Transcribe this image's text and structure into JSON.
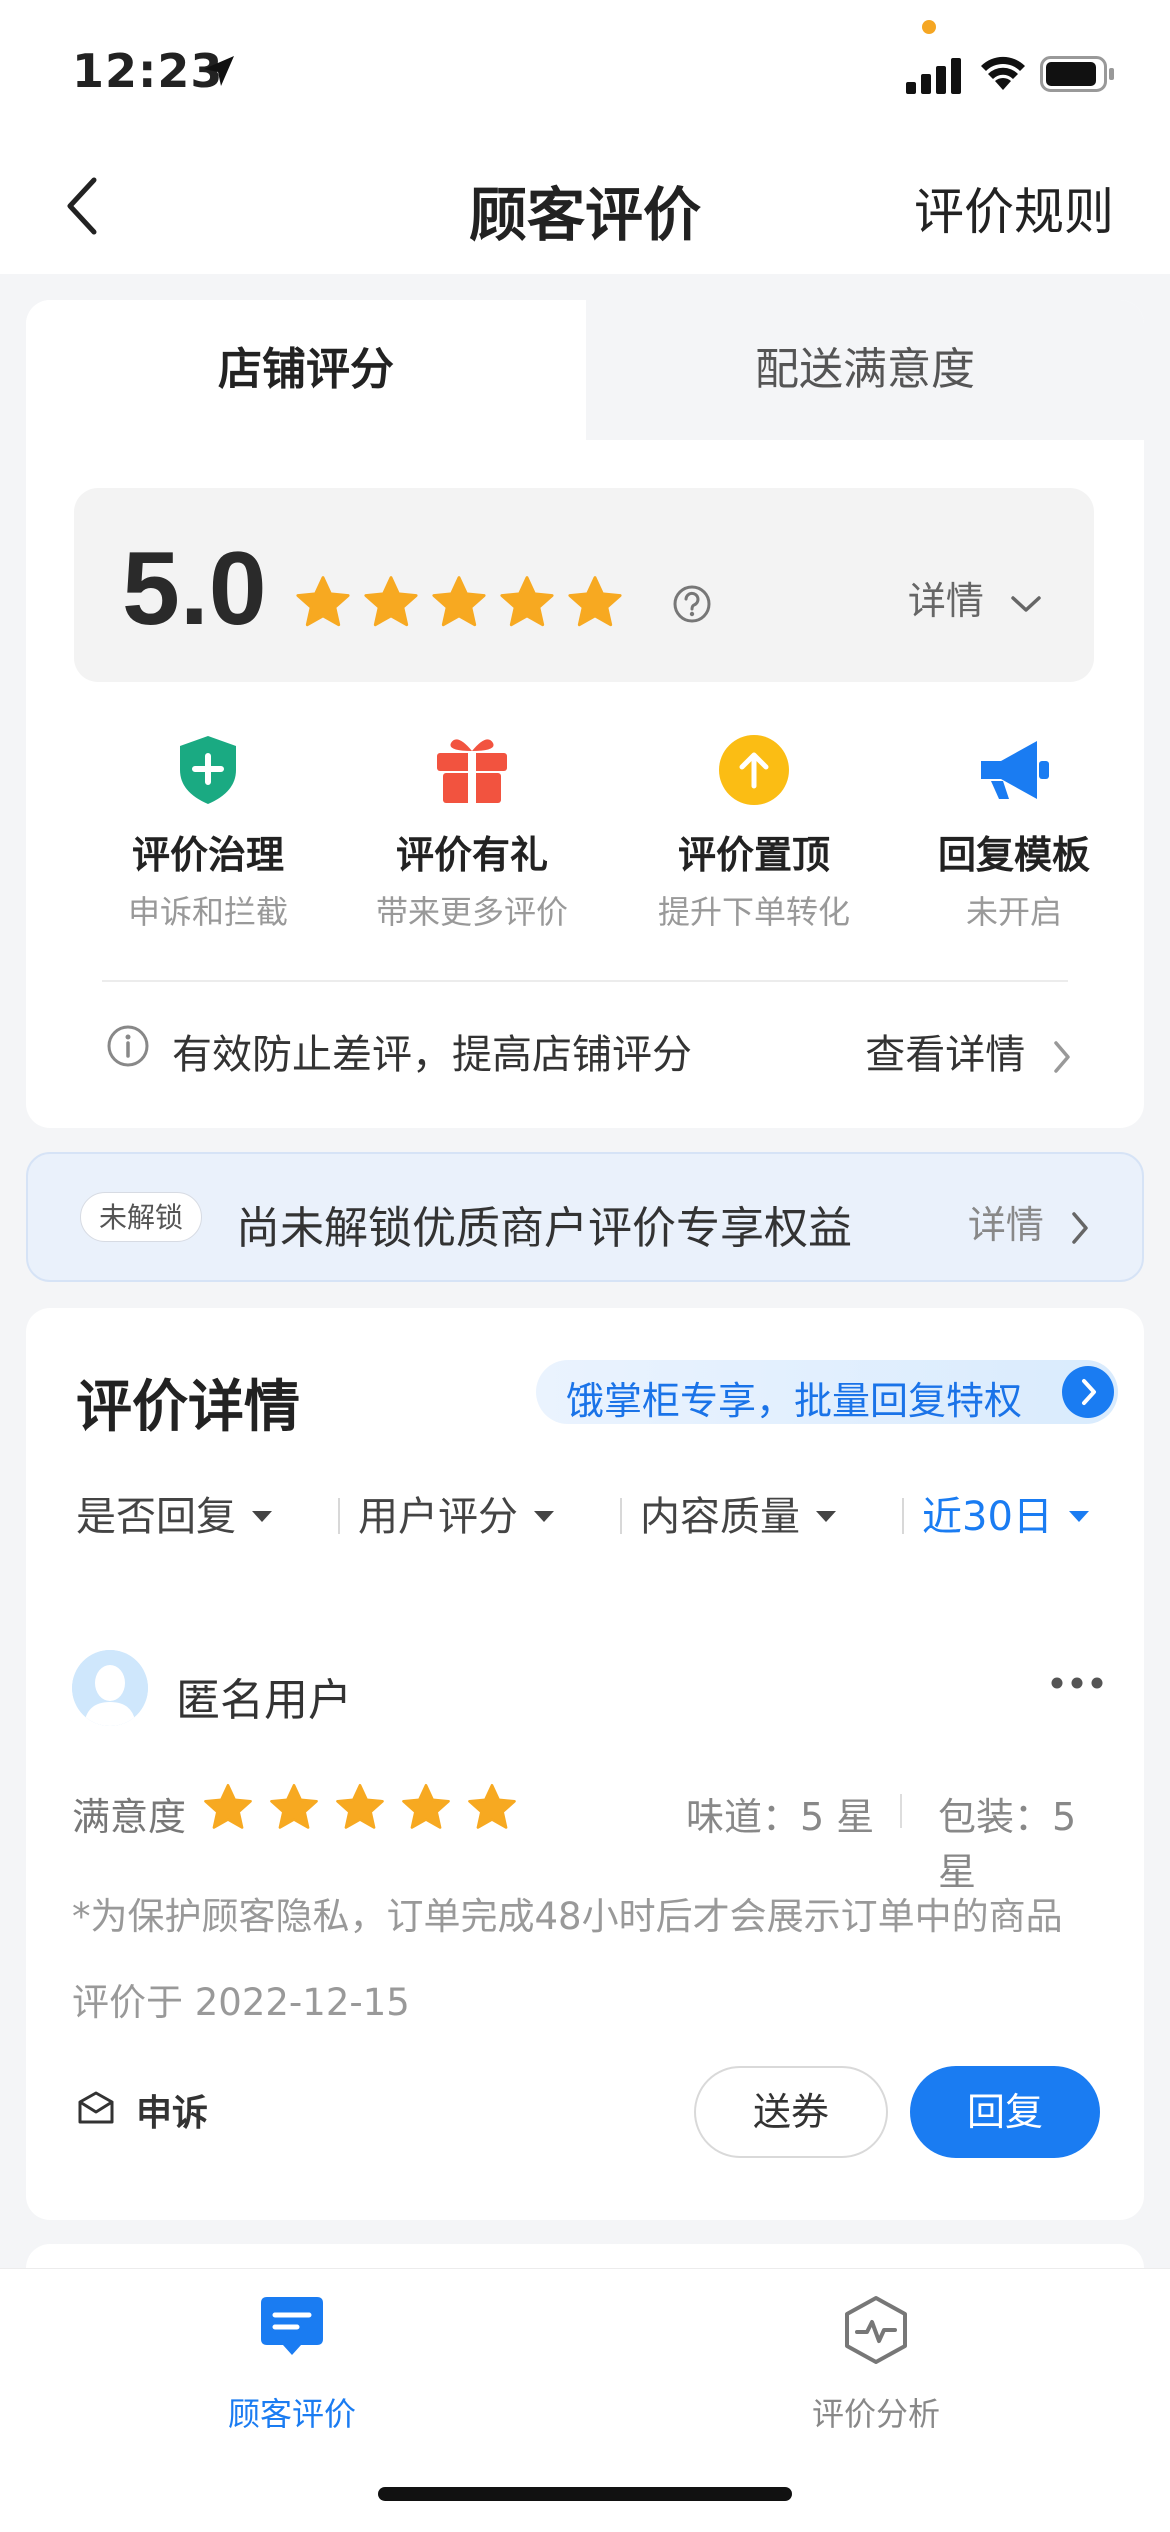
{
  "status_bar": {
    "time": "12:23"
  },
  "nav": {
    "title": "顾客评价",
    "right_action": "评价规则"
  },
  "score_card": {
    "tabs": [
      "店铺评分",
      "配送满意度"
    ],
    "active_tab": "店铺评分",
    "score": "5.0",
    "stars": 5,
    "detail_label": "详情",
    "features": [
      {
        "name": "评价治理",
        "sub": "申诉和拦截",
        "icon": "shield-plus-icon",
        "color": "#1aaa82"
      },
      {
        "name": "评价有礼",
        "sub": "带来更多评价",
        "icon": "gift-icon",
        "color": "#f2533f"
      },
      {
        "name": "评价置顶",
        "sub": "提升下单转化",
        "icon": "arrow-up-circle-icon",
        "color": "#fbbd14"
      },
      {
        "name": "回复模板",
        "sub": "未开启",
        "icon": "megaphone-icon",
        "color": "#1a7cf2"
      }
    ],
    "tip": {
      "text": "有效防止差评，提高店铺评分",
      "action": "查看详情"
    }
  },
  "unlock_banner": {
    "badge": "未解锁",
    "text": "尚未解锁优质商户评价专享权益",
    "action": "详情"
  },
  "review_section": {
    "title": "评价详情",
    "promo": "饿掌柜专享，批量回复特权",
    "filters": [
      {
        "label": "是否回复",
        "active": false
      },
      {
        "label": "用户评分",
        "active": false
      },
      {
        "label": "内容质量",
        "active": false
      },
      {
        "label": "近30日",
        "active": true
      }
    ],
    "review": {
      "user_name": "匿名用户",
      "satisfaction_label": "满意度",
      "stars": 5,
      "taste": "味道：5 星",
      "packaging": "包装：5 星",
      "privacy_note": "*为保护顾客隐私，订单完成48小时后才会展示订单中的商品",
      "date": "评价于 2022-12-15",
      "appeal_label": "申诉",
      "coupon_button": "送券",
      "reply_button": "回复"
    }
  },
  "tab_bar": {
    "items": [
      {
        "label": "顾客评价",
        "icon": "chat-bubble-icon",
        "active": true
      },
      {
        "label": "评价分析",
        "icon": "analysis-hexagon-icon",
        "active": false
      }
    ]
  },
  "colors": {
    "accent": "#1a7cf2",
    "star": "#f7a921",
    "background": "#f4f5f7"
  }
}
